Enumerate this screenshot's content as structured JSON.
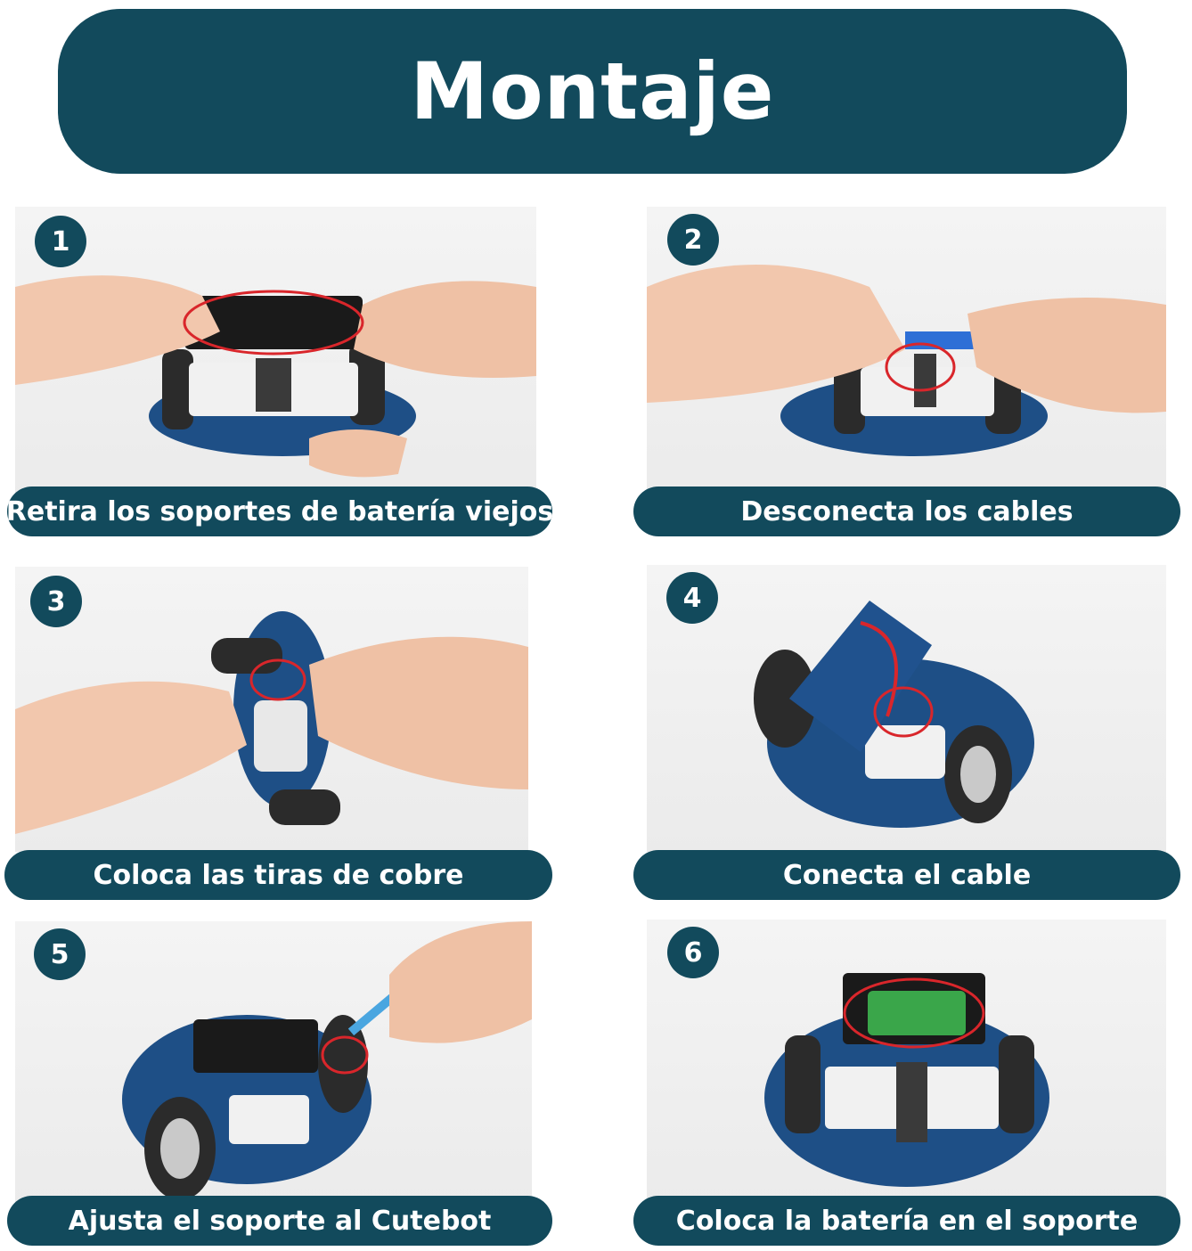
{
  "title": "Montaje",
  "colors": {
    "banner": "#124a5c",
    "text": "#ffffff",
    "highlight": "#d9262b"
  },
  "steps": [
    {
      "number": "1",
      "caption": "Retira los soportes de batería viejos",
      "icon": "battery-holder-removal"
    },
    {
      "number": "2",
      "caption": "Desconecta los cables",
      "icon": "cable-disconnect"
    },
    {
      "number": "3",
      "caption": "Coloca las tiras de cobre",
      "icon": "copper-strips"
    },
    {
      "number": "4",
      "caption": "Conecta el cable",
      "icon": "cable-connect"
    },
    {
      "number": "5",
      "caption": "Ajusta el soporte al Cutebot",
      "icon": "screwdriver"
    },
    {
      "number": "6",
      "caption": "Coloca la batería en el soporte",
      "icon": "battery-insert"
    }
  ]
}
